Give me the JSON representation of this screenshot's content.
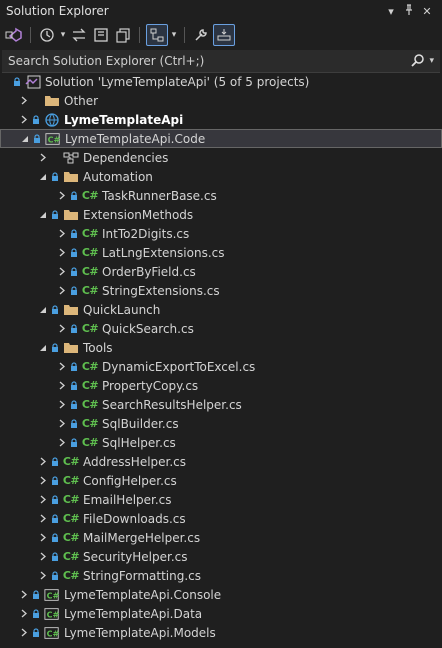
{
  "window": {
    "title": "Solution Explorer"
  },
  "search": {
    "placeholder": "Search Solution Explorer (Ctrl+;)"
  },
  "tree": [
    {
      "label": "Solution 'LymeTemplateApi' (5 of 5 projects)",
      "depth": 0,
      "expander": "none",
      "lock": true,
      "icon": "solution-icon"
    },
    {
      "label": "Other",
      "depth": 1,
      "expander": "collapsed",
      "lock": false,
      "icon": "folder-icon"
    },
    {
      "label": "LymeTemplateApi",
      "depth": 1,
      "expander": "collapsed",
      "lock": true,
      "icon": "web-project-icon",
      "bold": true
    },
    {
      "label": "LymeTemplateApi.Code",
      "depth": 1,
      "expander": "expanded",
      "lock": true,
      "icon": "csharp-project-icon",
      "selected": true
    },
    {
      "label": "Dependencies",
      "depth": 2,
      "expander": "collapsed",
      "lock": false,
      "icon": "dependencies-icon"
    },
    {
      "label": "Automation",
      "depth": 2,
      "expander": "expanded",
      "lock": true,
      "icon": "folder-icon"
    },
    {
      "label": "TaskRunnerBase.cs",
      "depth": 3,
      "expander": "collapsed",
      "lock": true,
      "icon": "csharp-file-icon"
    },
    {
      "label": "ExtensionMethods",
      "depth": 2,
      "expander": "expanded",
      "lock": true,
      "icon": "folder-icon"
    },
    {
      "label": "IntTo2Digits.cs",
      "depth": 3,
      "expander": "collapsed",
      "lock": true,
      "icon": "csharp-file-icon"
    },
    {
      "label": "LatLngExtensions.cs",
      "depth": 3,
      "expander": "collapsed",
      "lock": true,
      "icon": "csharp-file-icon"
    },
    {
      "label": "OrderByField.cs",
      "depth": 3,
      "expander": "collapsed",
      "lock": true,
      "icon": "csharp-file-icon"
    },
    {
      "label": "StringExtensions.cs",
      "depth": 3,
      "expander": "collapsed",
      "lock": true,
      "icon": "csharp-file-icon"
    },
    {
      "label": "QuickLaunch",
      "depth": 2,
      "expander": "expanded",
      "lock": true,
      "icon": "folder-icon"
    },
    {
      "label": "QuickSearch.cs",
      "depth": 3,
      "expander": "collapsed",
      "lock": true,
      "icon": "csharp-file-icon"
    },
    {
      "label": "Tools",
      "depth": 2,
      "expander": "expanded",
      "lock": true,
      "icon": "folder-icon"
    },
    {
      "label": "DynamicExportToExcel.cs",
      "depth": 3,
      "expander": "collapsed",
      "lock": true,
      "icon": "csharp-file-icon"
    },
    {
      "label": "PropertyCopy.cs",
      "depth": 3,
      "expander": "collapsed",
      "lock": true,
      "icon": "csharp-file-icon"
    },
    {
      "label": "SearchResultsHelper.cs",
      "depth": 3,
      "expander": "collapsed",
      "lock": true,
      "icon": "csharp-file-icon"
    },
    {
      "label": "SqlBuilder.cs",
      "depth": 3,
      "expander": "collapsed",
      "lock": true,
      "icon": "csharp-file-icon"
    },
    {
      "label": "SqlHelper.cs",
      "depth": 3,
      "expander": "collapsed",
      "lock": true,
      "icon": "csharp-file-icon"
    },
    {
      "label": "AddressHelper.cs",
      "depth": 2,
      "expander": "collapsed",
      "lock": true,
      "icon": "csharp-file-icon"
    },
    {
      "label": "ConfigHelper.cs",
      "depth": 2,
      "expander": "collapsed",
      "lock": true,
      "icon": "csharp-file-icon"
    },
    {
      "label": "EmailHelper.cs",
      "depth": 2,
      "expander": "collapsed",
      "lock": true,
      "icon": "csharp-file-icon"
    },
    {
      "label": "FileDownloads.cs",
      "depth": 2,
      "expander": "collapsed",
      "lock": true,
      "icon": "csharp-file-icon"
    },
    {
      "label": "MailMergeHelper.cs",
      "depth": 2,
      "expander": "collapsed",
      "lock": true,
      "icon": "csharp-file-icon"
    },
    {
      "label": "SecurityHelper.cs",
      "depth": 2,
      "expander": "collapsed",
      "lock": true,
      "icon": "csharp-file-icon"
    },
    {
      "label": "StringFormatting.cs",
      "depth": 2,
      "expander": "collapsed",
      "lock": true,
      "icon": "csharp-file-icon"
    },
    {
      "label": "LymeTemplateApi.Console",
      "depth": 1,
      "expander": "collapsed",
      "lock": true,
      "icon": "csharp-project-icon"
    },
    {
      "label": "LymeTemplateApi.Data",
      "depth": 1,
      "expander": "collapsed",
      "lock": true,
      "icon": "csharp-project-icon"
    },
    {
      "label": "LymeTemplateApi.Models",
      "depth": 1,
      "expander": "collapsed",
      "lock": true,
      "icon": "csharp-project-icon"
    }
  ],
  "colors": {
    "background": "#1f1f1f",
    "folder": "#dcb67a",
    "csharp": "#5fbf4f",
    "selection": "#37373d",
    "accent": "#6aa0e0"
  }
}
